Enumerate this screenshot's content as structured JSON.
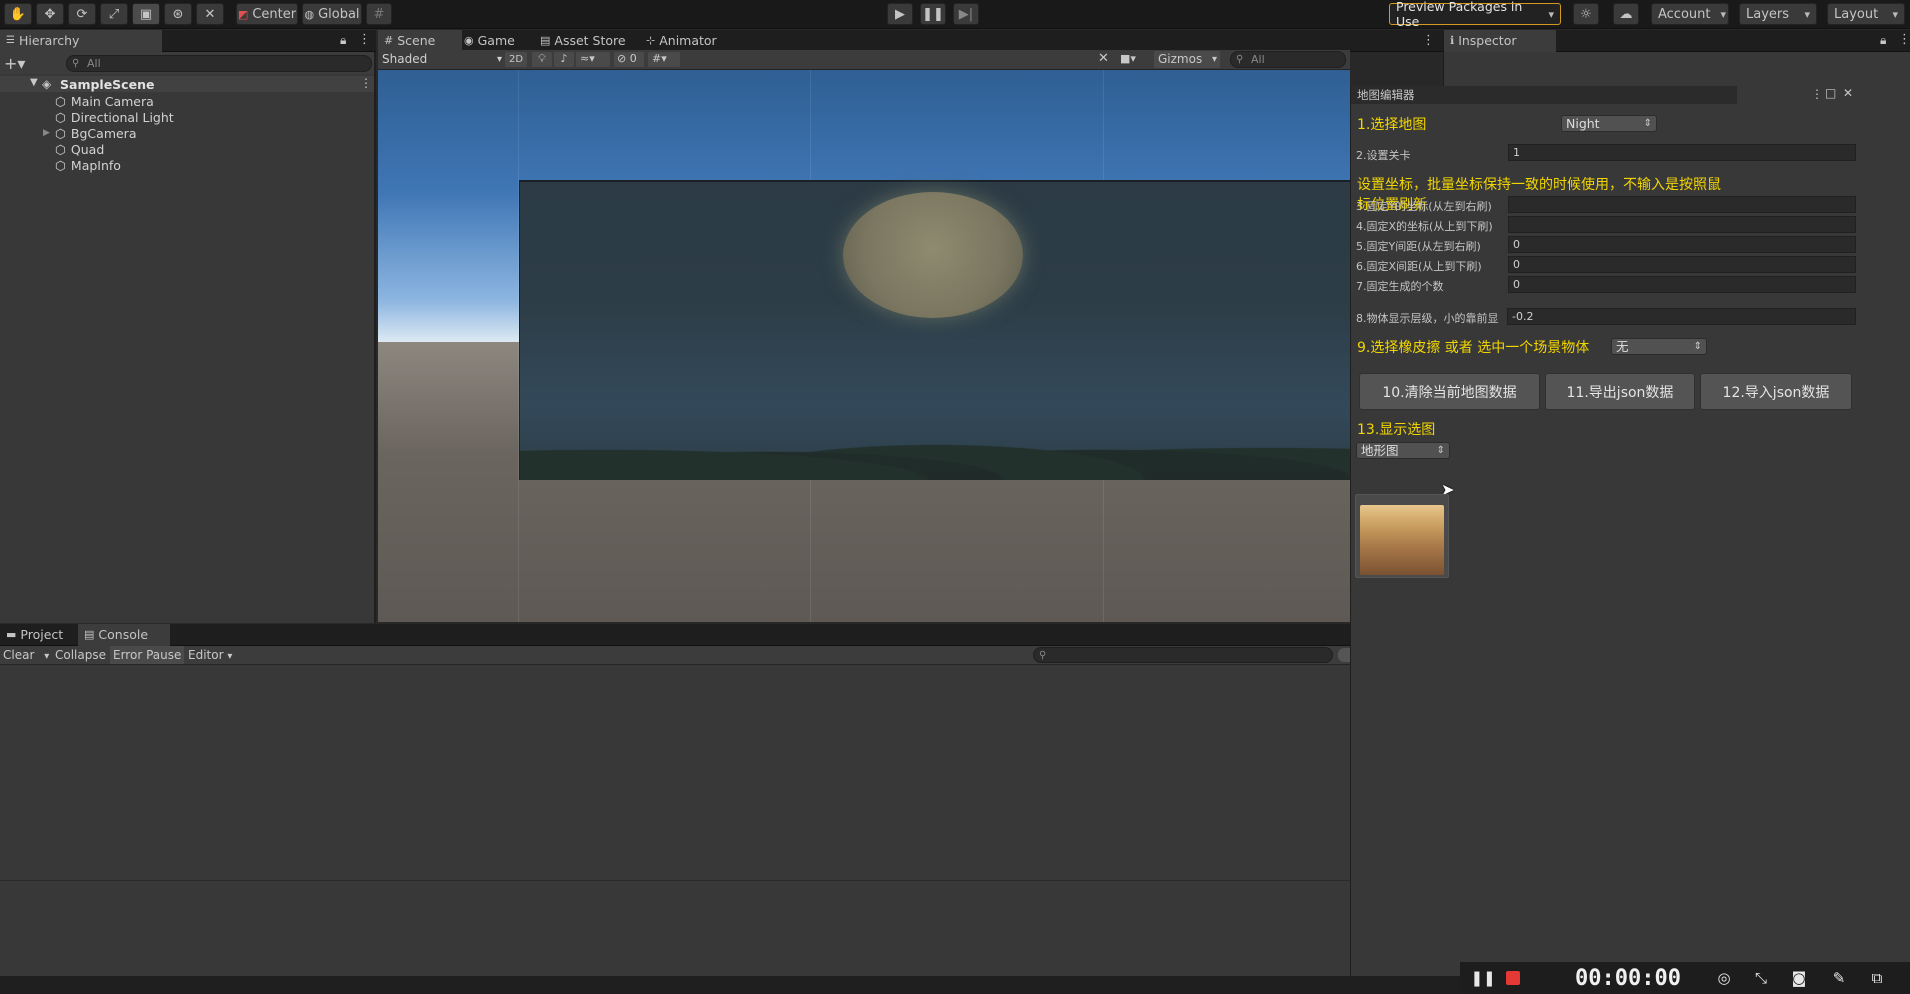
{
  "toolbar": {
    "center_label": "Center",
    "global_label": "Global",
    "packages_label": "Preview Packages in Use",
    "account_label": "Account",
    "layers_label": "Layers",
    "layout_label": "Layout",
    "colors": {
      "bg": "#191919",
      "packages_border": "#d39a1f"
    }
  },
  "hierarchy": {
    "tab_label": "Hierarchy",
    "search_placeholder": "All",
    "scene_name": "SampleScene",
    "items": [
      {
        "label": "Main Camera"
      },
      {
        "label": "Directional Light"
      },
      {
        "label": "BgCamera"
      },
      {
        "label": "Quad"
      },
      {
        "label": "MapInfo"
      }
    ]
  },
  "scene_tabs": {
    "scene": "Scene",
    "game": "Game",
    "asset_store": "Asset Store",
    "animator": "Animator"
  },
  "scene_toolbar": {
    "shading_mode": "Shaded",
    "mode_2d": "2D",
    "hidden_count": "0",
    "gizmos_label": "Gizmos",
    "search_placeholder": "All"
  },
  "inspector": {
    "tab_label": "Inspector"
  },
  "map_editor": {
    "title": "地图编辑器",
    "step1_label": "1.选择地图",
    "step1_value": "Night",
    "step2_label": "2.设置关卡",
    "step2_value": "1",
    "coord_note": "设置坐标，批量坐标保持一致的时候使用，不输入是按照鼠标位置刷新",
    "step3_label": "3.固定Y的坐标(从左到右刷)",
    "step3_value": "",
    "step4_label": "4.固定X的坐标(从上到下刷)",
    "step4_value": "",
    "step5_label": "5.固定Y间距(从左到右刷)",
    "step5_value": "0",
    "step6_label": "6.固定X间距(从上到下刷)",
    "step6_value": "0",
    "step7_label": "7.固定生成的个数",
    "step7_value": "0",
    "step8_label": "8.物体显示层级，小的靠前显",
    "step8_value": "-0.2",
    "step9_label": "9.选择橡皮擦 或者 选中一个场景物体",
    "step9_value": "无",
    "btn_clear": "10.清除当前地图数据",
    "btn_export": "11.导出json数据",
    "btn_import": "12.导入json数据",
    "step13_label": "13.显示选图",
    "step13_value": "地形图",
    "colors": {
      "accent_yellow": "#f2d600"
    }
  },
  "bottom_tabs": {
    "project": "Project",
    "console": "Console"
  },
  "console": {
    "clear_label": "Clear",
    "collapse_label": "Collapse",
    "error_pause_label": "Error Pause",
    "editor_label": "Editor"
  },
  "recorder": {
    "time": "00:00:00",
    "colors": {
      "stop": "#e53935"
    }
  }
}
